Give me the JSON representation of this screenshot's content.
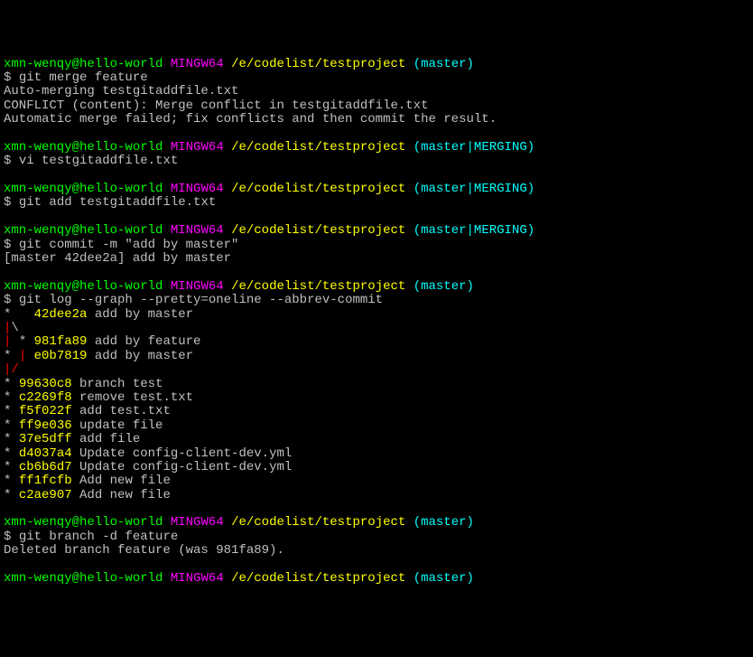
{
  "prompt": {
    "user_host": "xmn-wenqy@hello-world",
    "system": "MINGW64",
    "path": "/e/codelist/testproject",
    "branch_master": "(master)",
    "branch_merging": "(master|MERGING)"
  },
  "cmd": {
    "merge": "git merge feature",
    "vi": "vi testgitaddfile.txt",
    "add": "git add testgitaddfile.txt",
    "commit": "git commit -m \"add by master\"",
    "log": "git log --graph --pretty=oneline --abbrev-commit",
    "branch_del": "git branch -d feature"
  },
  "out": {
    "merge1": "Auto-merging testgitaddfile.txt",
    "merge2": "CONFLICT (content): Merge conflict in testgitaddfile.txt",
    "merge3": "Automatic merge failed; fix conflicts and then commit the result.",
    "commit1": "[master 42dee2a] add by master",
    "branch_del1": "Deleted branch feature (was 981fa89)."
  },
  "log": {
    "g_star": "*",
    "g_pipe": "|",
    "g_bslash": "\\",
    "g_fslash": "/",
    "h1": "42dee2a",
    "m1": "add by master",
    "h2": "981fa89",
    "m2": "add by feature",
    "h3": "e0b7819",
    "m3": "add by master",
    "h4": "99630c8",
    "m4": "branch test",
    "h5": "c2269f8",
    "m5": "remove test.txt",
    "h6": "f5f022f",
    "m6": "add test.txt",
    "h7": "ff9e036",
    "m7": "update file",
    "h8": "37e5dff",
    "m8": "add file",
    "h9": "d4037a4",
    "m9": "Update config-client-dev.yml",
    "h10": "cb6b6d7",
    "m10": "Update config-client-dev.yml",
    "h11": "ff1fcfb",
    "m11": "Add new file",
    "h12": "c2ae907",
    "m12": "Add new file"
  },
  "s": {
    "dollar": "$ ",
    "sp": " ",
    "sp3": "   "
  }
}
